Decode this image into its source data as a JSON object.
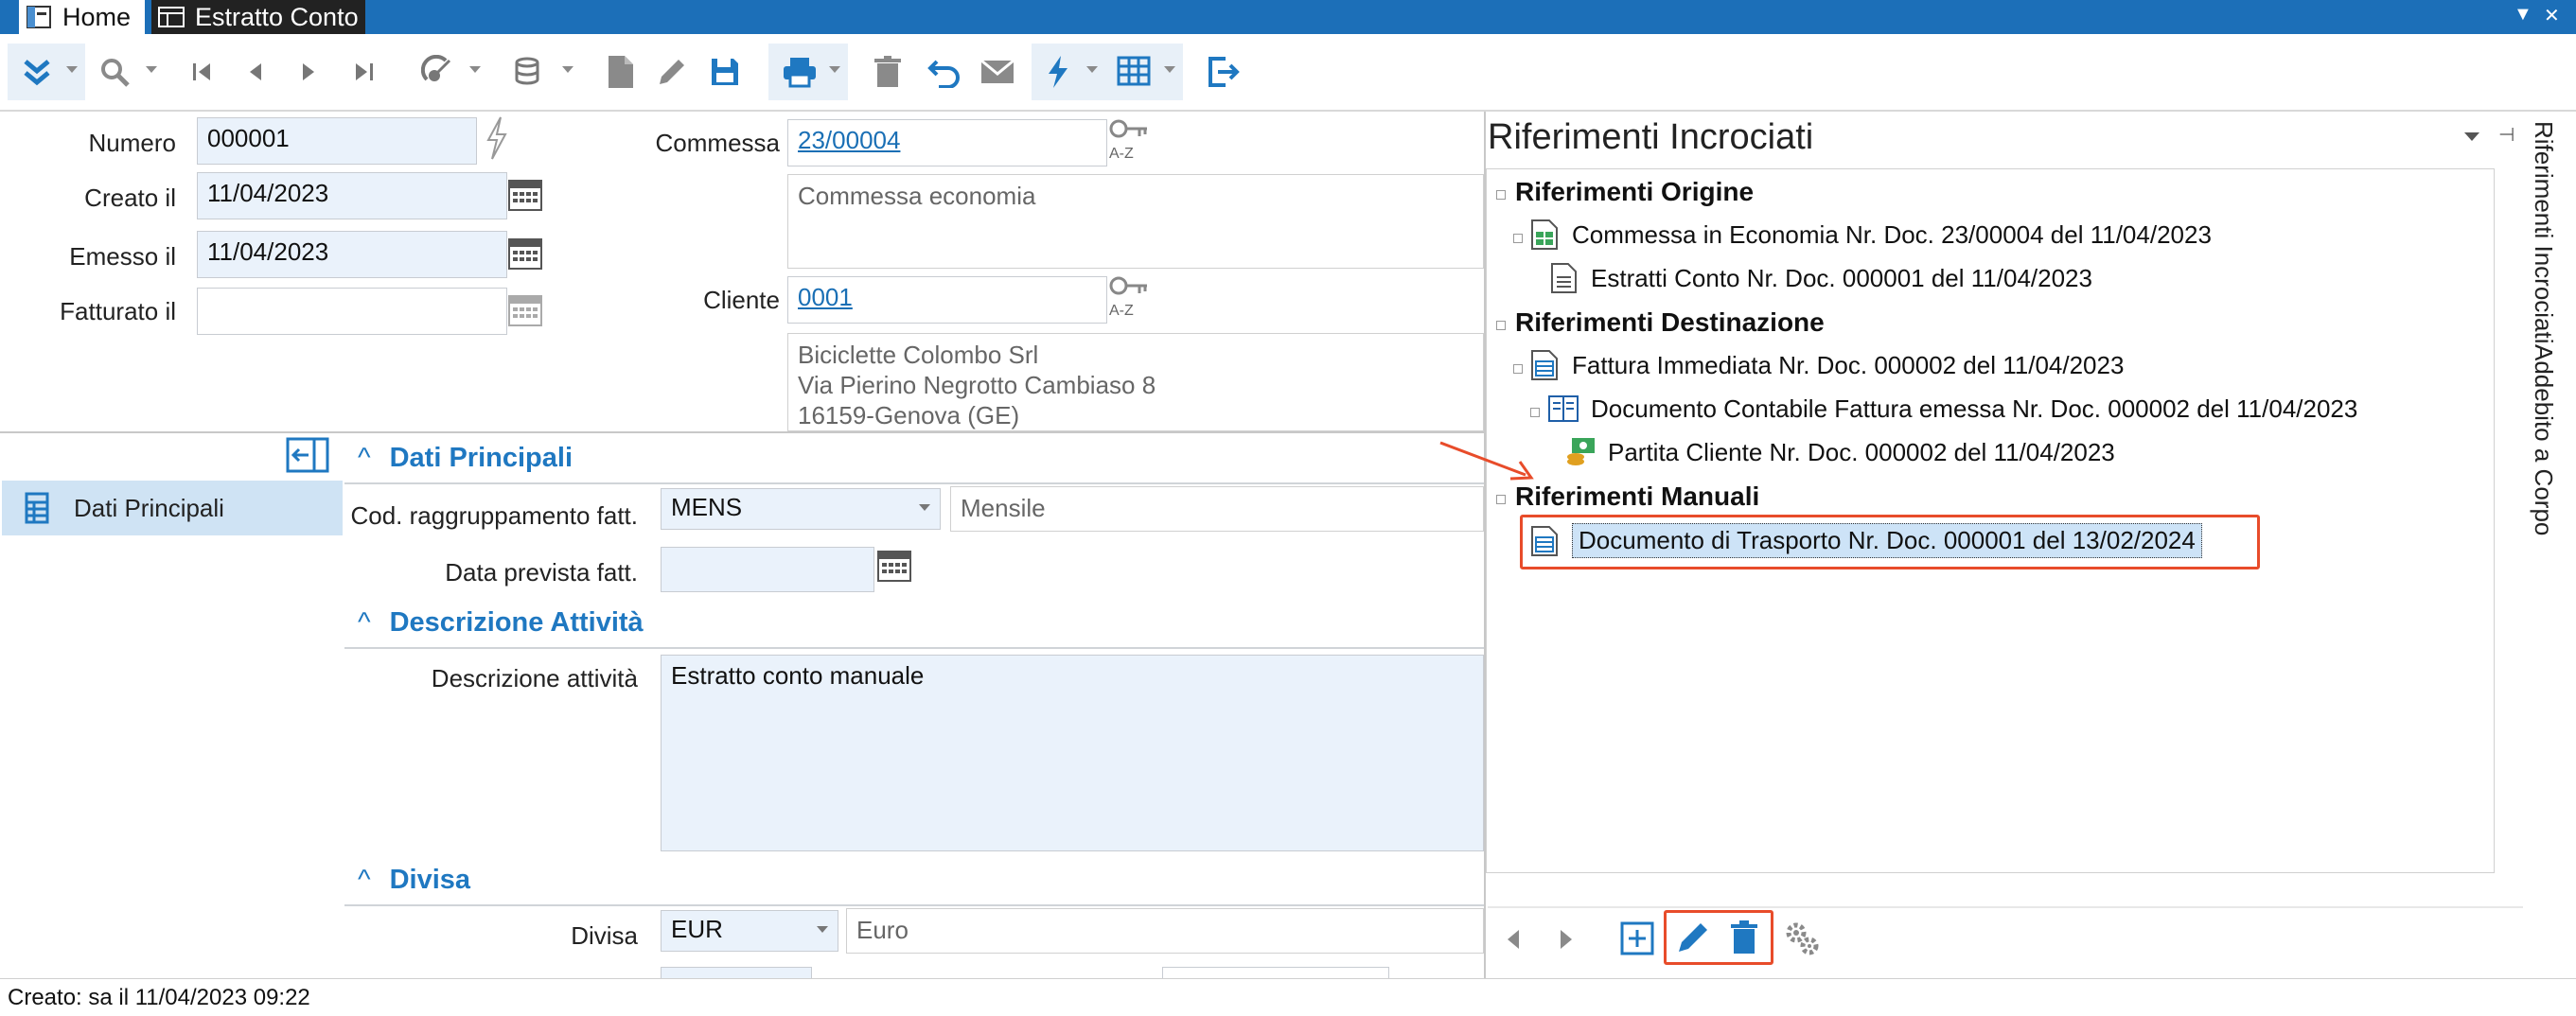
{
  "tabs": [
    {
      "label": "Home",
      "icon": "home-icon"
    },
    {
      "label": "Estratto Conto",
      "icon": "grid-icon"
    }
  ],
  "toolbar": {
    "icons": [
      "expand-menu-icon",
      "search-icon",
      "first-record-icon",
      "previous-record-icon",
      "next-record-icon",
      "last-record-icon",
      "satellite-icon",
      "database-icon",
      "new-document-icon",
      "edit-icon",
      "save-icon",
      "print-icon",
      "delete-icon",
      "undo-icon",
      "email-icon",
      "lightning-icon",
      "grid-options-icon",
      "exit-icon"
    ]
  },
  "header": {
    "numero_label": "Numero",
    "numero_value": "000001",
    "creato_label": "Creato il",
    "creato_value": "11/04/2023",
    "emesso_label": "Emesso il",
    "emesso_value": "11/04/2023",
    "fatturato_label": "Fatturato il",
    "fatturato_value": "",
    "commessa_label": "Commessa",
    "commessa_value": "23/00004",
    "commessa_desc": "Commessa economia",
    "cliente_label": "Cliente",
    "cliente_value": "0001",
    "cliente_name": "Biciclette Colombo Srl",
    "cliente_address": "Via Pierino Negrotto Cambiaso 8",
    "cliente_city": "16159-Genova (GE)",
    "az_text": "A-Z"
  },
  "sidebar": {
    "items": [
      {
        "label": "Dati Principali",
        "icon": "table-icon"
      }
    ]
  },
  "sections": {
    "dati_principali": "Dati Principali",
    "cod_label": "Cod. raggruppamento fatt.",
    "cod_value": "MENS",
    "cod_desc": "Mensile",
    "data_prevista_label": "Data prevista fatt.",
    "data_prevista_value": "",
    "descrizione_attivita_head": "Descrizione Attività",
    "descrizione_label": "Descrizione attività",
    "descrizione_value": "Estratto conto manuale",
    "divisa_head": "Divisa",
    "divisa_label": "Divisa",
    "divisa_value": "EUR",
    "divisa_desc": "Euro"
  },
  "right_panel": {
    "title": "Riferimenti Incrociati",
    "vertical_tabs": [
      "Riferimenti Incrociati",
      "Addebito a Corpo"
    ],
    "tree": {
      "origine_head": "Riferimenti Origine",
      "origine_1": "Commessa in Economia Nr. Doc. 23/00004 del 11/04/2023",
      "origine_2": "Estratti Conto Nr. Doc. 000001 del 11/04/2023",
      "destinazione_head": "Riferimenti Destinazione",
      "dest_1": "Fattura Immediata Nr. Doc. 000002 del 11/04/2023",
      "dest_2": "Documento Contabile Fattura emessa Nr. Doc. 000002 del 11/04/2023",
      "dest_3": "Partita Cliente Nr. Doc. 000002 del 11/04/2023",
      "manuali_head": "Riferimenti Manuali",
      "manuali_1": "Documento di Trasporto Nr. Doc. 000001 del 13/02/2024"
    }
  },
  "status": {
    "text": "Creato: sa il 11/04/2023 09:22"
  },
  "colors": {
    "accent": "#1f78c1",
    "tabbar": "#1c6fb8",
    "highlight": "#e84c2a",
    "selection": "#cde3f7"
  }
}
